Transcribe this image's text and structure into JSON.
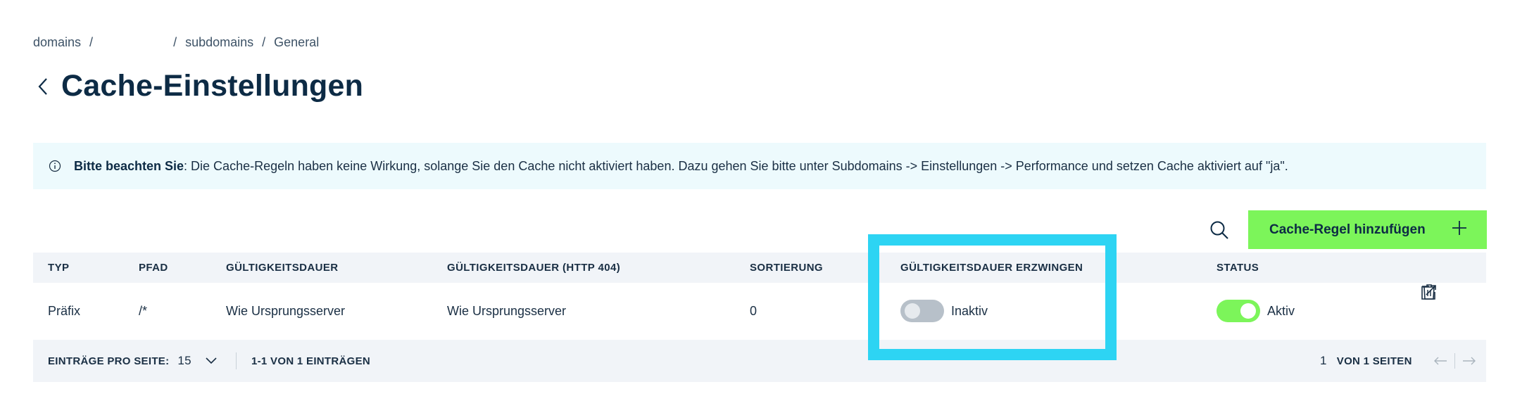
{
  "breadcrumb": {
    "items": [
      "domains",
      "",
      "subdomains",
      "General"
    ],
    "separator": "/"
  },
  "page": {
    "title": "Cache-Einstellungen"
  },
  "notice": {
    "bold": "Bitte beachten Sie",
    "text": ": Die Cache-Regeln haben keine Wirkung, solange Sie den Cache nicht aktiviert haben. Dazu gehen Sie bitte unter Subdomains -> Einstellungen -> Performance und setzen Cache aktiviert auf \"ja\"."
  },
  "toolbar": {
    "add_label": "Cache-Regel hinzufügen",
    "add_icon": "plus-icon",
    "search_icon": "search-icon"
  },
  "table": {
    "headers": {
      "typ": "TYP",
      "pfad": "PFAD",
      "gueltigkeit": "GÜLTIGKEITSDAUER",
      "gueltigkeit404": "GÜLTIGKEITSDAUER (HTTP 404)",
      "sortierung": "SORTIERUNG",
      "erzwingen": "GÜLTIGKEITSDAUER ERZWINGEN",
      "status": "STATUS"
    },
    "rows": [
      {
        "typ": "Präfix",
        "pfad": "/*",
        "gueltigkeit": "Wie Ursprungsserver",
        "gueltigkeit404": "Wie Ursprungsserver",
        "sortierung": "0",
        "erzwingen_label": "Inaktiv",
        "erzwingen_on": false,
        "status_label": "Aktiv",
        "status_on": true
      }
    ]
  },
  "footer": {
    "per_page_label": "EINTRÄGE PRO SEITE:",
    "per_page_value": "15",
    "entries_summary": "1-1 VON 1 EINTRÄGEN",
    "page_current": "1",
    "page_total_label": "VON 1 SEITEN"
  },
  "colors": {
    "accent_green": "#7cf55a",
    "highlight_cyan": "#2dd4f3",
    "notice_bg": "#edfafd",
    "header_bg": "#f1f4f8",
    "title": "#0d2b45"
  }
}
